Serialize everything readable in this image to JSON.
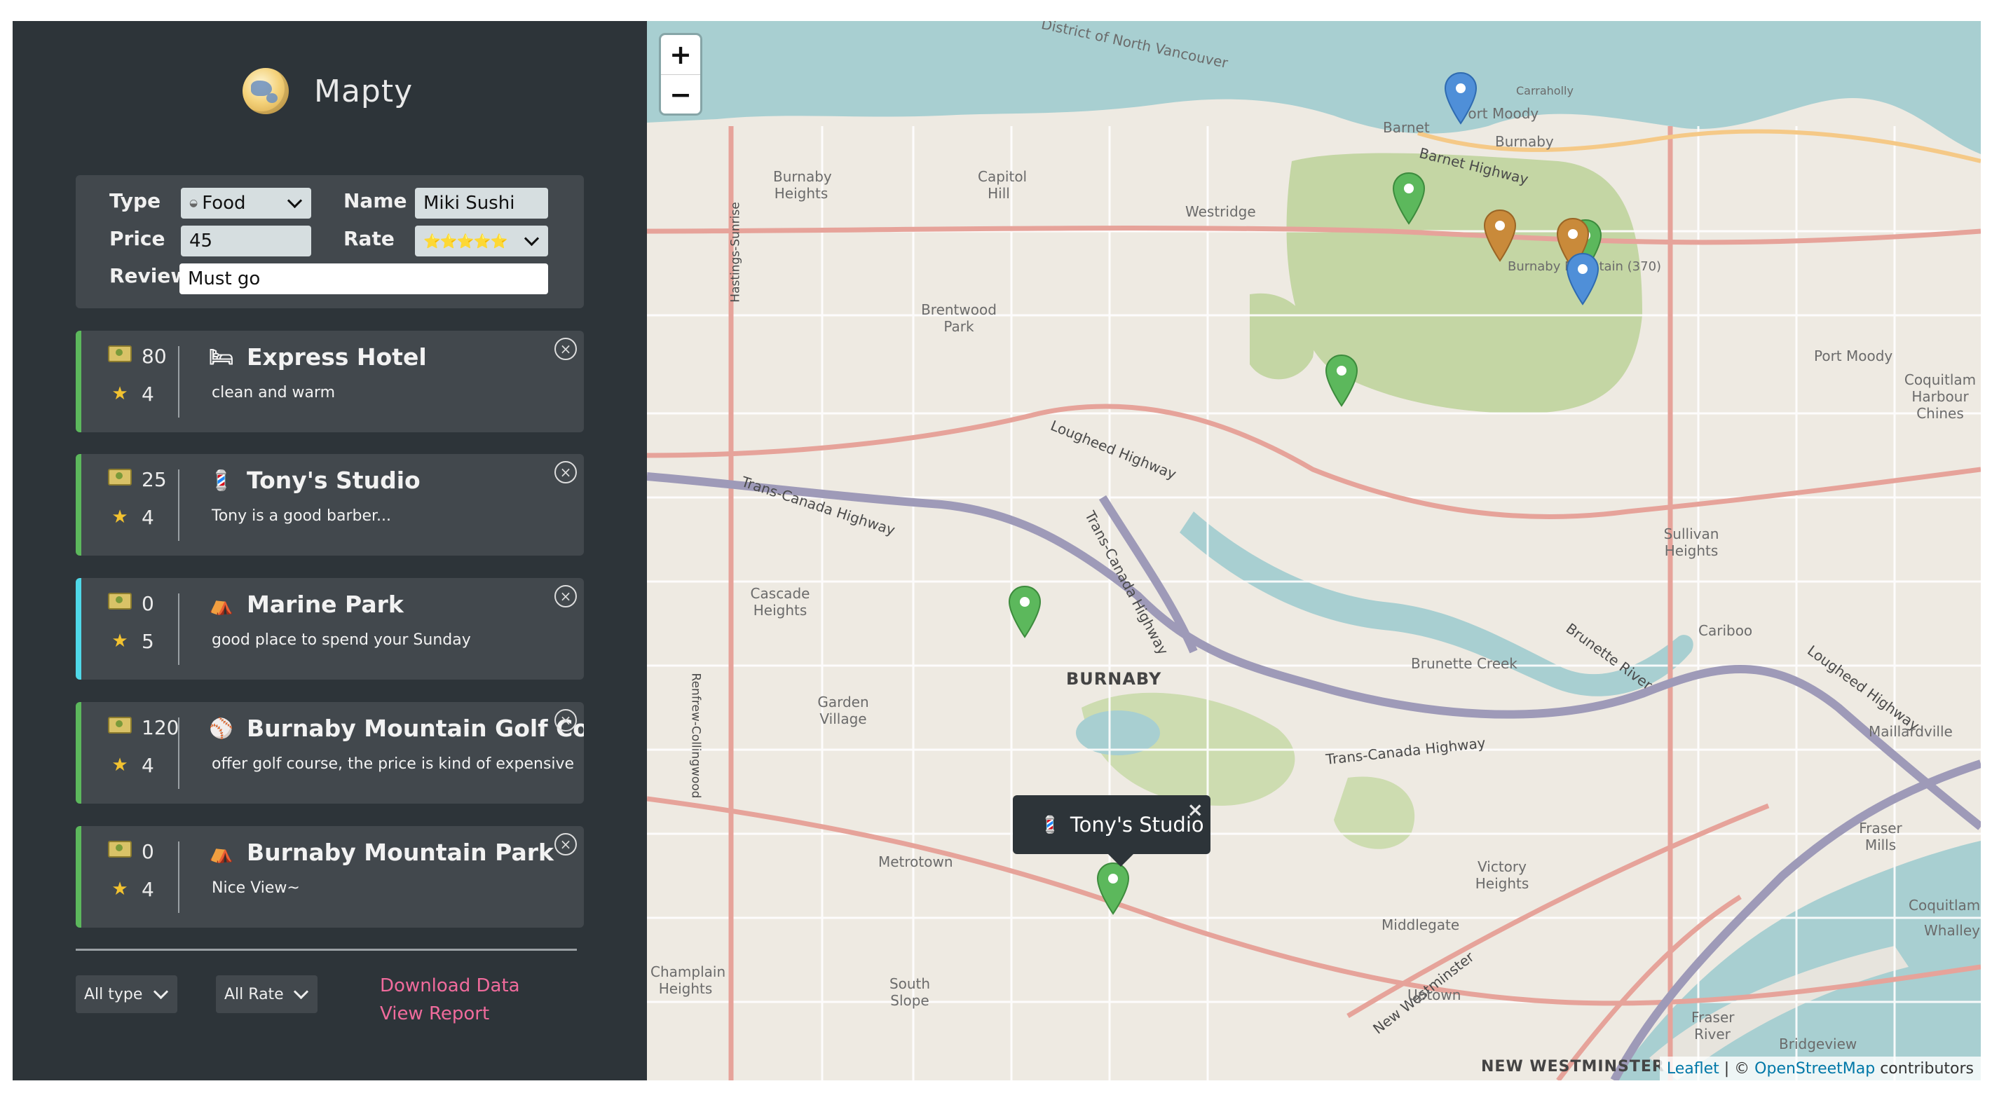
{
  "app": {
    "title": "Mapty"
  },
  "form": {
    "type_label": "Type",
    "type_icon": "food-icon",
    "type_value": "Food",
    "name_label": "Name",
    "name_value": "Miki Sushi",
    "price_label": "Price",
    "price_value": "45",
    "rate_label": "Rate",
    "rate_value": "⭐⭐⭐⭐⭐",
    "review_label": "Review",
    "review_value": "Must go"
  },
  "workouts": [
    {
      "price": "80",
      "rating": "4",
      "icon": "bed-icon",
      "icon_glyph": "🛏",
      "title": "Express Hotel",
      "description": "clean and warm",
      "accent": "#5cb85c"
    },
    {
      "price": "25",
      "rating": "4",
      "icon": "barber-pole-icon",
      "icon_glyph": "💈",
      "title": "Tony's Studio",
      "description": "Tony is a good barber...",
      "accent": "#5cb85c"
    },
    {
      "price": "0",
      "rating": "5",
      "icon": "camping-icon",
      "icon_glyph": "⛺",
      "title": "Marine Park",
      "description": "good place to spend your Sunday",
      "accent": "#4fd8e8"
    },
    {
      "price": "120",
      "rating": "4",
      "icon": "ball-icon",
      "icon_glyph": "⚾",
      "title": "Burnaby Mountain Golf Cours",
      "description": "offer golf course, the price is kind of expensive",
      "accent": "#5cb85c"
    },
    {
      "price": "0",
      "rating": "4",
      "icon": "camping-icon",
      "icon_glyph": "⛺",
      "title": "Burnaby Mountain Park",
      "description": "Nice View~",
      "accent": "#5cb85c"
    }
  ],
  "filters": {
    "type_value": "All type",
    "rate_value": "All Rate"
  },
  "links": {
    "download": "Download Data",
    "report": "View Report"
  },
  "map": {
    "zoom_in": "+",
    "zoom_out": "−",
    "labels": {
      "burnaby": "BURNABY",
      "new_westminster": "NEW WESTMINSTER",
      "port_moody": "Port Moody",
      "port_moody_east": "Port Moody",
      "burnaby_heights": "Burnaby Heights",
      "capitol_hill": "Capitol Hill",
      "westridge": "Westridge",
      "brentwood_park": "Brentwood Park",
      "cascade_heights": "Cascade Heights",
      "garden_village": "Garden Village",
      "metrotown": "Metrotown",
      "south_slope": "South Slope",
      "champlain_heights": "Champlain Heights",
      "sullivan_heights": "Sullivan Heights",
      "cariboo": "Cariboo",
      "victory_heights": "Victory Heights",
      "middlegate": "Middlegate",
      "uptown": "Uptown",
      "fraser_river": "Fraser River",
      "coquitlam_chines": "Coquitlam Harbour Chines",
      "maillardville": "Maillardville",
      "fraser_mills": "Fraser Mills",
      "brunette_creek": "Brunette Creek",
      "coquitlam": "Coquitlam",
      "whalley": "Whalley",
      "bridgeview": "Bridgeview",
      "burnaby_mountain": "Burnaby Mountain (370)",
      "carraholly": "Carraholly",
      "barnet": "Barnet",
      "burnaby_top": "Burnaby",
      "north_vancouver": "District of North Vancouver",
      "trans_canada_1": "Trans-Canada Highway",
      "trans_canada_2": "Trans-Canada Highway",
      "trans_canada_3": "Trans-Canada Highway",
      "lougheed_1": "Lougheed Highway",
      "lougheed_2": "Lougheed Highway",
      "barnet_highway": "Barnet Highway",
      "hastings_sunrise": "Hastings-Sunrise",
      "renfrew_collingwood": "Renfrew-Collingwood",
      "brunette_river": "Brunette River",
      "new_westminster_road": "New Westminster"
    },
    "popup": {
      "icon": "barber-pole-icon",
      "icon_glyph": "💈",
      "text": "Tony's Studio",
      "close": "×"
    },
    "attribution": {
      "leaflet": "Leaflet",
      "sep": " | © ",
      "osm": "OpenStreetMap",
      "suffix": " contributors"
    },
    "marker_colors": {
      "green": "#5cb85c",
      "blue": "#4f8fd8",
      "orange": "#c98a3a"
    }
  }
}
